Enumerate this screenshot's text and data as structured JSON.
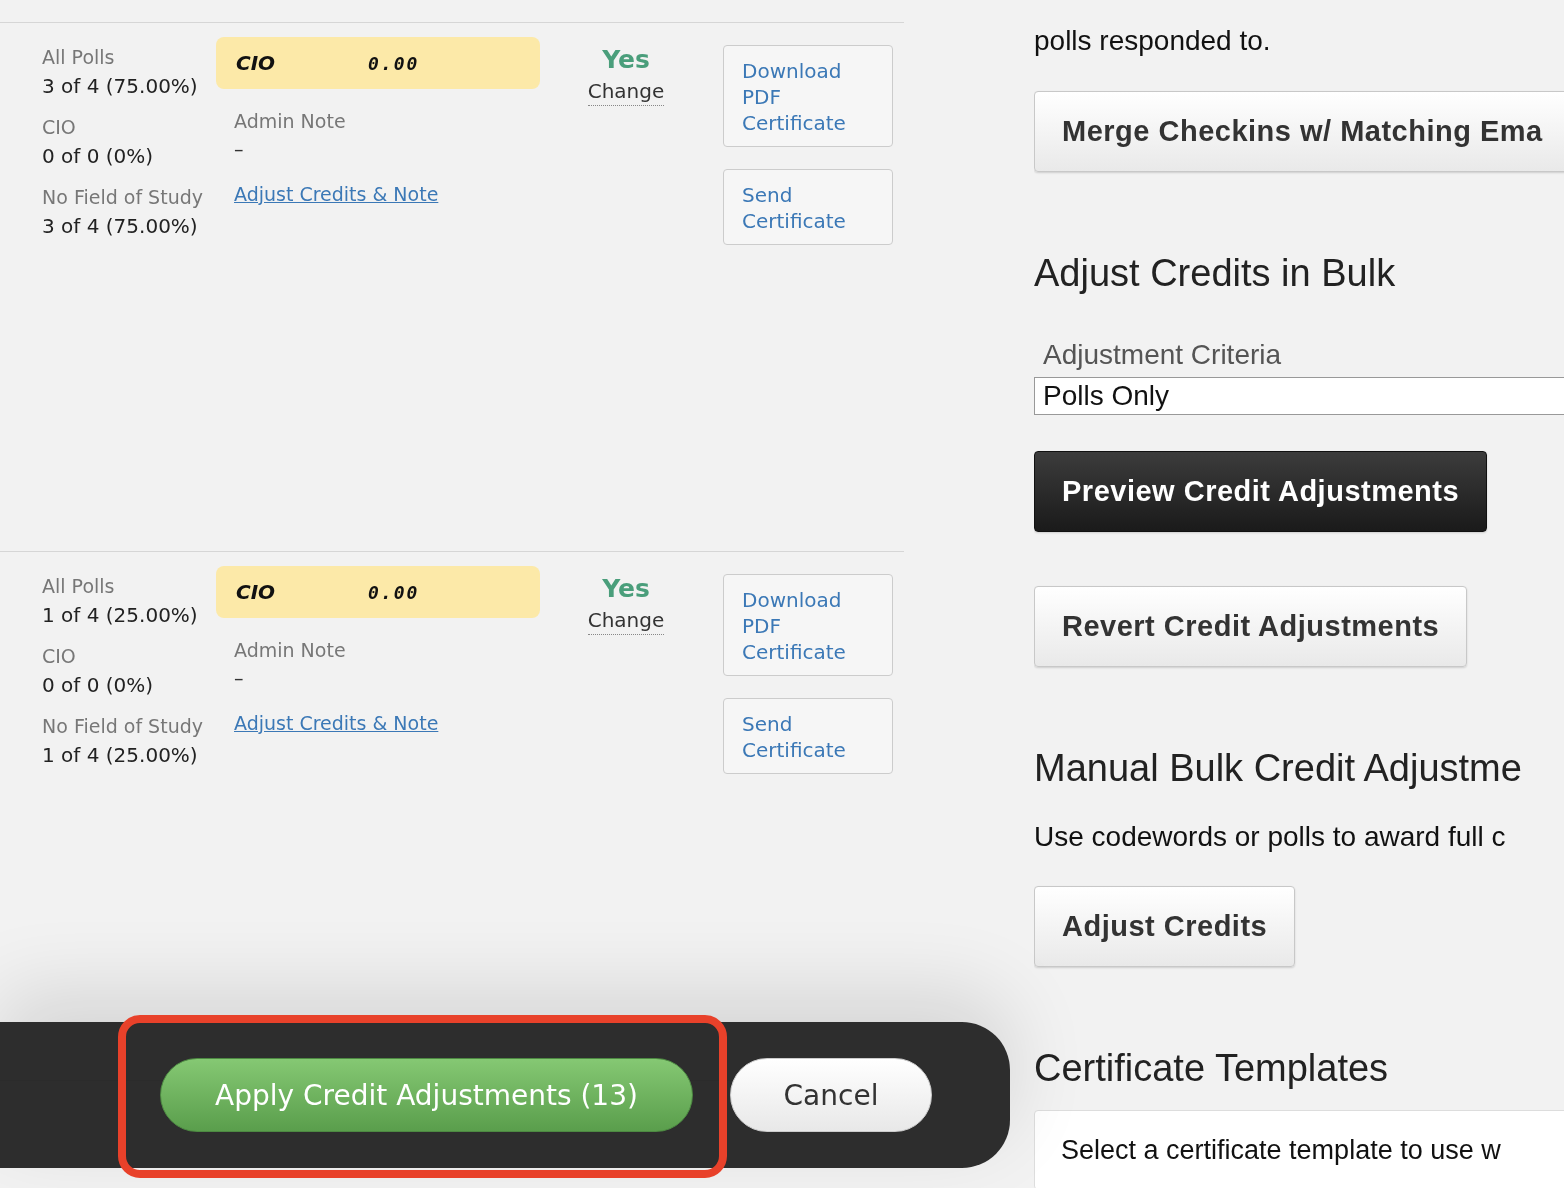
{
  "rows": [
    {
      "stats": [
        {
          "label": "All Polls",
          "value": "3 of 4 (75.00%)"
        },
        {
          "label": "CIO",
          "value": "0 of 0 (0%)"
        },
        {
          "label": "No Field of Study",
          "value": "3 of 4 (75.00%)"
        }
      ],
      "credit": {
        "name": "CIO",
        "amount": "0.00"
      },
      "note_label": "Admin Note",
      "note": "–",
      "adjust_link": "Adjust Credits & Note",
      "status": "Yes",
      "change": "Change",
      "buttons": [
        "Download PDF Certificate",
        "Send Certificate"
      ]
    },
    {
      "stats": [
        {
          "label": "All Polls",
          "value": "1 of 4 (25.00%)"
        },
        {
          "label": "CIO",
          "value": "0 of 0 (0%)"
        },
        {
          "label": "No Field of Study",
          "value": "1 of 4 (25.00%)"
        }
      ],
      "credit": {
        "name": "CIO",
        "amount": "0.00"
      },
      "note_label": "Admin Note",
      "note": "–",
      "adjust_link": "Adjust Credits & Note",
      "status": "Yes",
      "change": "Change",
      "buttons": [
        "Download PDF Certificate",
        "Send Certificate"
      ]
    },
    {
      "stats": []
    }
  ],
  "side": {
    "intro_lines": [
      "polls responded to."
    ],
    "merge_button": "Merge Checkins w/ Matching Ema",
    "bulk_heading": "Adjust Credits in Bulk",
    "criteria_label": "Adjustment Criteria",
    "criteria_value": "Polls Only",
    "preview_button": "Preview Credit Adjustments",
    "revert_button": "Revert Credit Adjustments",
    "manual_heading": "Manual Bulk Credit Adjustme",
    "manual_text": "Use codewords or polls to award full c",
    "adjust_button": "Adjust Credits",
    "templates_heading": "Certificate Templates",
    "template_text": "Select a certificate template to use w"
  },
  "action_bar": {
    "apply": {
      "label": "Apply Credit Adjustments (13)",
      "highlighted": true
    },
    "cancel": "Cancel"
  }
}
